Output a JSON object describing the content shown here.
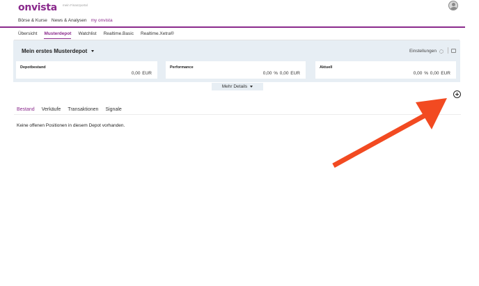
{
  "brand": {
    "logo": "onvista",
    "tagline": "mein Finanzportal"
  },
  "main_nav": [
    "Börse & Kurse",
    "News & Analysen",
    "my onvista"
  ],
  "sub_nav": [
    "Übersicht",
    "Musterdepot",
    "Watchlist",
    "Realtime.Basic",
    "Realtime.Xetra®"
  ],
  "depot": {
    "title": "Mein erstes Musterdepot",
    "settings_label": "Einstellungen",
    "cards": [
      {
        "label": "Depotbestand",
        "value": "0,00 EUR"
      },
      {
        "label": "Performance",
        "value": "0,00 %   0,00 EUR"
      },
      {
        "label": "Aktuell",
        "value": "0,00 %   0,00 EUR"
      }
    ],
    "more_details_label": "Mehr Details"
  },
  "tabs": [
    "Bestand",
    "Verkäufe",
    "Transaktionen",
    "Signale"
  ],
  "empty_message": "Keine offenen Positionen in diesem Depot vorhanden.",
  "colors": {
    "accent": "#8a2a8c",
    "panel": "#e7eef4",
    "arrow": "#f24a21"
  },
  "icons": [
    "avatar-icon",
    "chevron-down-icon",
    "gear-icon",
    "print-icon",
    "plus-circle-icon",
    "arrow-annotation"
  ]
}
